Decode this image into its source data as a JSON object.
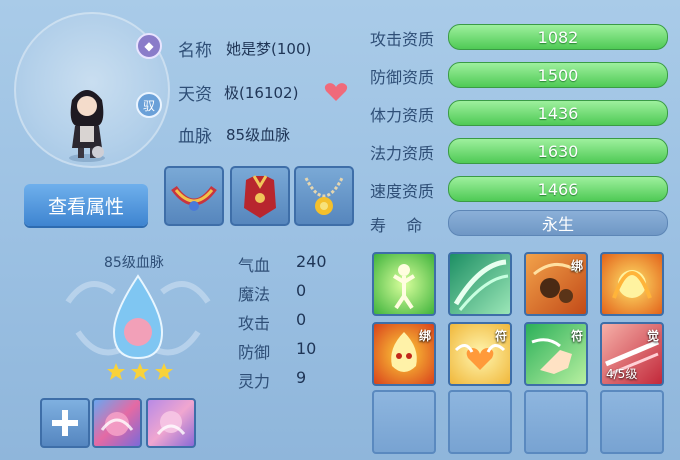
{
  "profile": {
    "name_label": "名称",
    "name_value": "她是梦(100)",
    "aptitude_label": "天资",
    "aptitude_value": "极(16102)",
    "bloodline_label": "血脉",
    "bloodline_value": "85级血脉",
    "badge_bind": "驭",
    "attr_button": "查看属性"
  },
  "stats": [
    {
      "label": "攻击资质",
      "value": "1082"
    },
    {
      "label": "防御资质",
      "value": "1500"
    },
    {
      "label": "体力资质",
      "value": "1436"
    },
    {
      "label": "法力资质",
      "value": "1630"
    },
    {
      "label": "速度资质",
      "value": "1466"
    }
  ],
  "life": {
    "label": "寿    命",
    "value": "永生"
  },
  "bloodline_panel": {
    "title": "85级血脉",
    "stars": 3,
    "stats": [
      {
        "label": "气血",
        "value": "240"
      },
      {
        "label": "魔法",
        "value": "0"
      },
      {
        "label": "攻击",
        "value": "0"
      },
      {
        "label": "防御",
        "value": "10"
      },
      {
        "label": "灵力",
        "value": "9"
      }
    ]
  },
  "skills": [
    {
      "tag": "",
      "level": ""
    },
    {
      "tag": "",
      "level": ""
    },
    {
      "tag": "绑",
      "level": ""
    },
    {
      "tag": "",
      "level": ""
    },
    {
      "tag": "绑",
      "level": ""
    },
    {
      "tag": "符",
      "level": ""
    },
    {
      "tag": "符",
      "level": ""
    },
    {
      "tag": "觉",
      "level": "4/5级"
    }
  ],
  "colors": {
    "accent": "#4fca55",
    "button": "#3e84d0",
    "panel": "#9cc1e3"
  }
}
